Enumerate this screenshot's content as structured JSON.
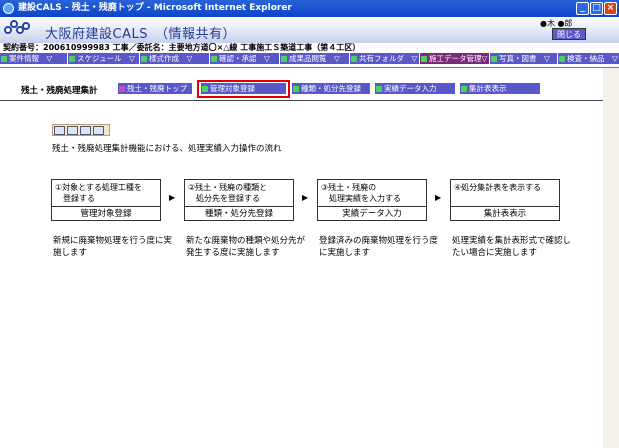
{
  "window": {
    "title": "建設CALS - 残土・残廃トップ - Microsoft Internet Explorer",
    "buttons": [
      "_",
      "□",
      "×"
    ]
  },
  "header": {
    "app_title": "大阪府建設CALS　（情報共有）",
    "user": "●木 ●郎",
    "close_label": "閉じる"
  },
  "contract": {
    "text": "契約番号：200610999983 工事／委託名：主要地方道〇×△線 工事施工Ｓ築道工事（第４工区）"
  },
  "menu": {
    "items": [
      "案件情報　▽",
      "スケジュール　▽",
      "様式作成　▽",
      "確認・承認　▽",
      "成果品閲覧　▽",
      "共有フォルダ　▽",
      "施工データ管理▽",
      "写真・図書　▽",
      "検査・納品　▽"
    ]
  },
  "sub": {
    "title": "残土・残廃処理集計",
    "tabs": [
      "残土・残廃トップ",
      "管理対象登録",
      "種類・処分先登録",
      "実績データ入力",
      "集計表表示"
    ]
  },
  "description": "残土・残廃処理集計機能における、処理実績入力操作の流れ",
  "flow": [
    {
      "top": "①対象とする処理工種を\n　登録する",
      "bottom": "管理対象登録",
      "note": "新規に廃棄物処理を行う度に実施します"
    },
    {
      "top": "②残土・残廃の種類と\n　処分先を登録する",
      "bottom": "種類・処分先登録",
      "note": "新たな廃棄物の種類や処分先が発生する度に実施します"
    },
    {
      "top": "③残土・残廃の\n　処理実績を入力する",
      "bottom": "実績データ入力",
      "note": "登録済みの廃棄物処理を行う度に実施します"
    },
    {
      "top": "④処分集計表を表示する",
      "bottom": "集計表表示",
      "note": "処理実績を集計表形式で確認したい場合に実施します"
    }
  ],
  "arrows": [
    "▶",
    "▶",
    "▶"
  ]
}
